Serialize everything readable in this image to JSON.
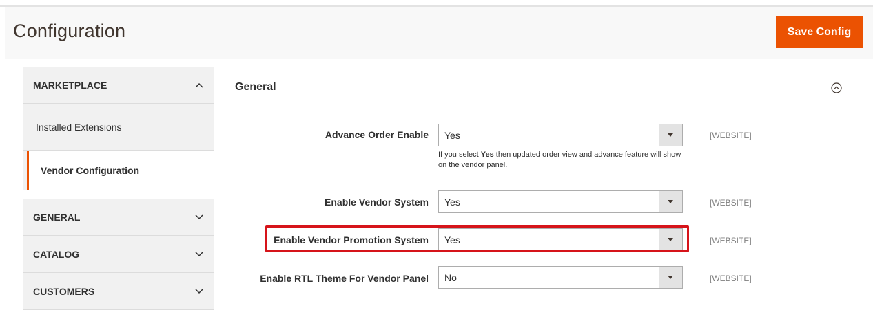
{
  "header": {
    "title": "Configuration",
    "save_label": "Save Config"
  },
  "sidebar": {
    "marketplace": {
      "label": "MARKETPLACE",
      "items": [
        {
          "label": "Installed Extensions"
        },
        {
          "label": "Vendor Configuration",
          "active": true
        }
      ]
    },
    "tabs": [
      {
        "label": "GENERAL"
      },
      {
        "label": "CATALOG"
      },
      {
        "label": "CUSTOMERS"
      }
    ]
  },
  "section": {
    "title": "General",
    "fields": [
      {
        "label": "Advance Order Enable",
        "value": "Yes",
        "scope": "[WEBSITE]",
        "note_pre": "If you select ",
        "note_bold": "Yes",
        "note_post": " then updated order view and advance feature will show on the vendor panel."
      },
      {
        "label": "Enable Vendor System",
        "value": "Yes",
        "scope": "[WEBSITE]"
      },
      {
        "label": "Enable Vendor Promotion System",
        "value": "Yes",
        "scope": "[WEBSITE]",
        "highlighted": true
      },
      {
        "label": "Enable RTL Theme For Vendor Panel",
        "value": "No",
        "scope": "[WEBSITE]"
      }
    ]
  },
  "colors": {
    "accent": "#eb5202",
    "highlight": "#d6141a"
  }
}
